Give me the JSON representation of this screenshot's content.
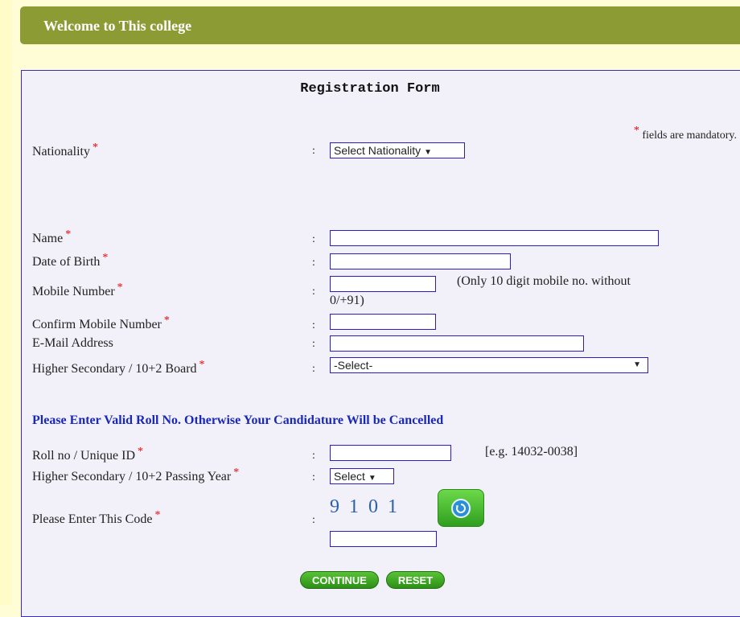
{
  "header": {
    "title": "Welcome to This college"
  },
  "form": {
    "title": "Registration Form",
    "mandatory_note": "fields are mandatory.",
    "required_mark": "*",
    "colon": ":",
    "fields": {
      "nationality": {
        "label": "Nationality",
        "selected": "Select Nationality"
      },
      "name": {
        "label": "Name",
        "value": ""
      },
      "dob": {
        "label": "Date of Birth",
        "value": ""
      },
      "mobile": {
        "label": "Mobile Number",
        "value": "",
        "hint_line1": "(Only 10 digit mobile no. without",
        "hint_line2": "0/+91)"
      },
      "confirm_mobile": {
        "label": "Confirm Mobile Number",
        "value": ""
      },
      "email": {
        "label": "E-Mail Address",
        "value": ""
      },
      "board": {
        "label": "Higher Secondary / 10+2 Board",
        "selected": "-Select-"
      },
      "roll": {
        "label": "Roll no / Unique ID",
        "value": "",
        "example": "[e.g. 14032-0038]"
      },
      "passing_year": {
        "label": "Higher Secondary / 10+2 Passing Year",
        "selected": "Select"
      },
      "captcha": {
        "label": "Please Enter This Code",
        "code": "9 1 0 1",
        "value": ""
      }
    },
    "warning": "Please Enter Valid Roll No. Otherwise Your Candidature Will be Cancelled",
    "buttons": {
      "continue": "CONTINUE",
      "reset": "RESET"
    }
  },
  "icons": {
    "refresh": "refresh-icon",
    "dropdown": "dropdown-arrow-icon"
  },
  "colors": {
    "header_bg": "#8c9b33",
    "page_bg": "#fefdd6",
    "form_bg": "#f2f0f8",
    "accent_border": "#2a1cc0",
    "warning_text": "#1a28b8",
    "button_green": "#2c8f17"
  }
}
